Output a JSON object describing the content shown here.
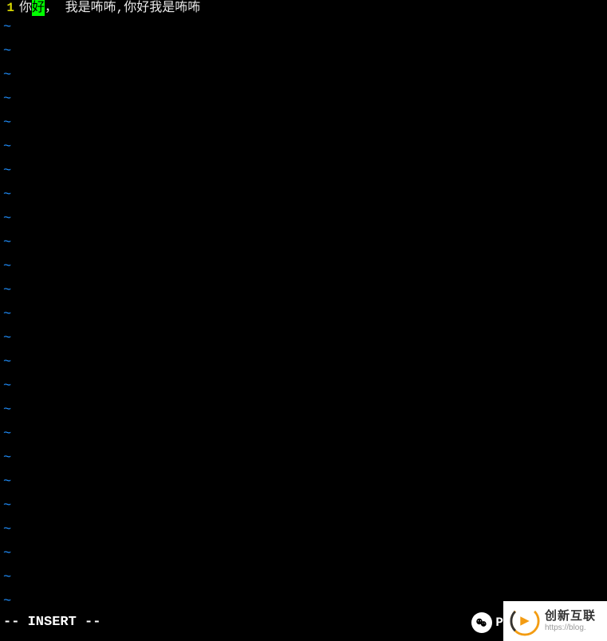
{
  "editor": {
    "line_number": "1",
    "text_before_cursor": "你",
    "cursor_char": "好",
    "text_after_cursor": "， 我是咘咘,你好我是咘咘",
    "tilde": "~",
    "tilde_count": 25
  },
  "status": {
    "mode": "-- INSERT --"
  },
  "watermark": {
    "wechat_label": "P",
    "logo_text": "创新互联",
    "url_text": "https://blog."
  }
}
